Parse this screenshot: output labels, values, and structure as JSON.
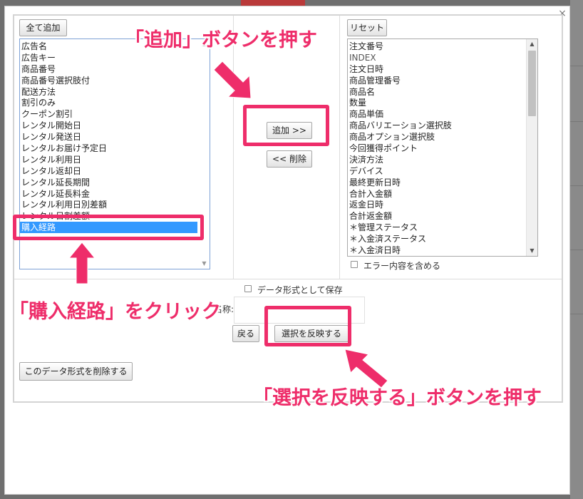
{
  "dialog": {
    "close_glyph": "×"
  },
  "left_panel": {
    "add_all_label": "全て追加",
    "items": [
      "広告名",
      "広告キー",
      "商品番号",
      "商品番号選択肢付",
      "配送方法",
      "割引のみ",
      "クーポン割引",
      "レンタル開始日",
      "レンタル発送日",
      "レンタルお届け予定日",
      "レンタル利用日",
      "レンタル返却日",
      "レンタル延長期間",
      "レンタル延長料金",
      "レンタル利用日別差額",
      "レンタル日割差額",
      "購入経路"
    ],
    "selected_item": "購入経路"
  },
  "middle_panel": {
    "add_label": "追加 >>",
    "remove_label": "<< 削除"
  },
  "right_panel": {
    "reset_label": "リセット",
    "items": [
      "注文番号",
      "INDEX",
      "注文日時",
      "商品管理番号",
      "商品名",
      "数量",
      "商品単価",
      "商品バリエーション選択肢",
      "商品オプション選択肢",
      "今回獲得ポイント",
      "決済方法",
      "デバイス",
      "最終更新日時",
      "合計入金額",
      "返金日時",
      "合計返金額",
      "＊管理ステータス",
      "＊入金済ステータス",
      "＊入金済日時"
    ],
    "include_errors_label": "エラー内容を含める"
  },
  "footer": {
    "save_format_label": "データ形式として保存",
    "name_label": "名称:",
    "name_value": "",
    "back_label": "戻る",
    "apply_label": "選択を反映する",
    "delete_format_label": "このデータ形式を削除する"
  },
  "annotations": {
    "press_add": "「追加」ボタンを押す",
    "click_route": "「購入経路」をクリック",
    "press_apply": "「選択を反映する」ボタンを押す",
    "accent_color": "#ee2d6a"
  }
}
